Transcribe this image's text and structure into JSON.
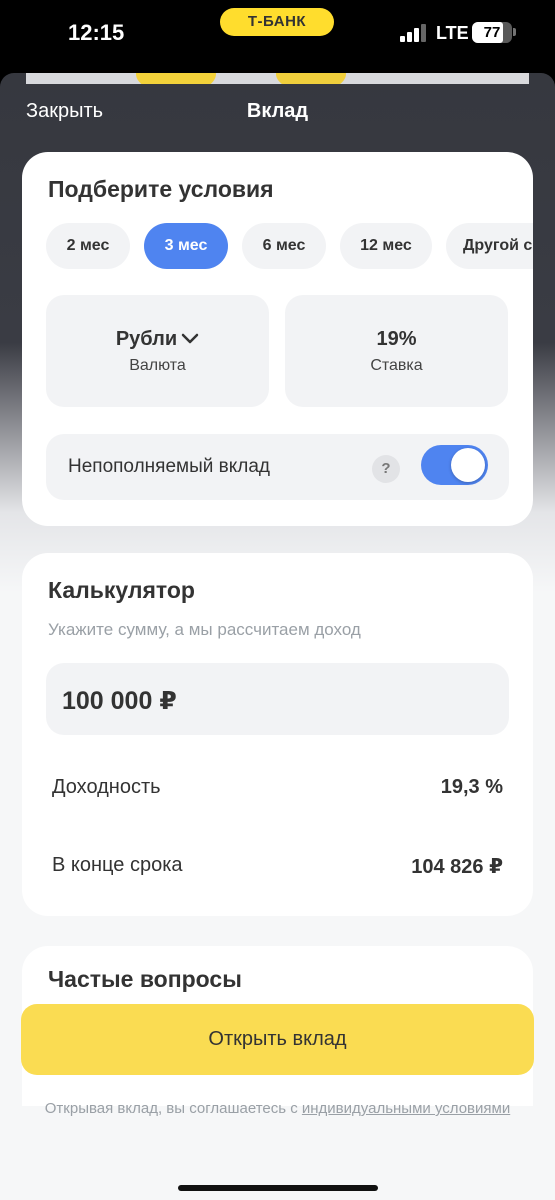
{
  "status_bar": {
    "time": "12:15",
    "carrier_pill": "Т-БАНК",
    "network": "LTE",
    "battery": "77",
    "battery_level": 0.77,
    "icons": [
      "signal-icon",
      "battery-icon"
    ]
  },
  "nav": {
    "close_label": "Закрыть",
    "title": "Вклад"
  },
  "terms": {
    "title": "Подберите условия",
    "periods": [
      "2 мес",
      "3 мес",
      "6 мес",
      "12 мес",
      "Другой срок"
    ],
    "selected_period": "3 мес",
    "currency_value": "Рубли",
    "currency_label": "Валюта",
    "rate_value": "19%",
    "rate_label": "Ставка",
    "toggle_label": "Непополняемый вклад",
    "help_symbol": "?",
    "toggle_on": true
  },
  "calculator": {
    "title": "Калькулятор",
    "subtitle": "Укажите сумму, а мы рассчитаем доход",
    "amount": "100 000 ₽",
    "yield_label": "Доходность",
    "yield_value": "19,3 %",
    "end_label": "В конце срока",
    "end_value": "104 826 ₽"
  },
  "faq": {
    "title": "Частые вопросы"
  },
  "cta": {
    "label": "Открыть вклад"
  },
  "legal": {
    "text": "Открывая вклад, вы соглашаетесь с ",
    "link": "индивидуальными условиями"
  },
  "colors": {
    "accent": "#4f84f0",
    "brand_yellow": "#ffdd2d",
    "cta_yellow": "#fadc52"
  }
}
